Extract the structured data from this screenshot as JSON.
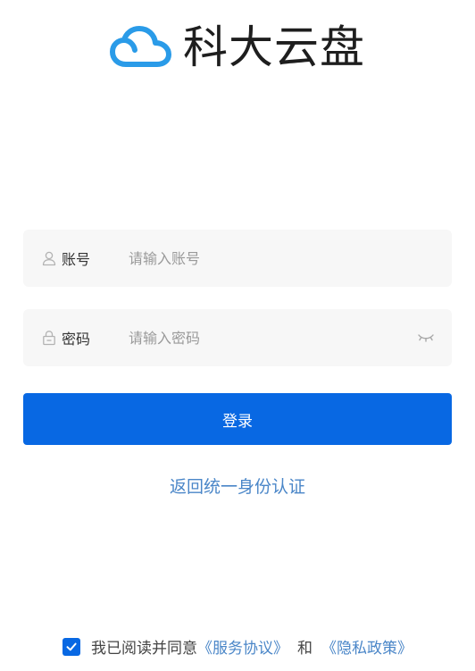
{
  "brand": {
    "title": "科大云盘",
    "logo_icon": "cloud-icon",
    "logo_color": "#2a9be8"
  },
  "form": {
    "account": {
      "icon": "user-icon",
      "label": "账号",
      "placeholder": "请输入账号",
      "value": ""
    },
    "password": {
      "icon": "lock-icon",
      "label": "密码",
      "placeholder": "请输入密码",
      "value": "",
      "toggle_icon": "eye-closed-icon"
    },
    "submit_label": "登录"
  },
  "sso_link": "返回统一身份认证",
  "agreement": {
    "checked": true,
    "prefix": "我已阅读并同意",
    "service_link": "《服务协议》",
    "conjunction": "和",
    "privacy_link": "《隐私政策》"
  },
  "colors": {
    "primary": "#0868e3",
    "link": "#4a86c8",
    "field_bg": "#f7f7f7"
  }
}
